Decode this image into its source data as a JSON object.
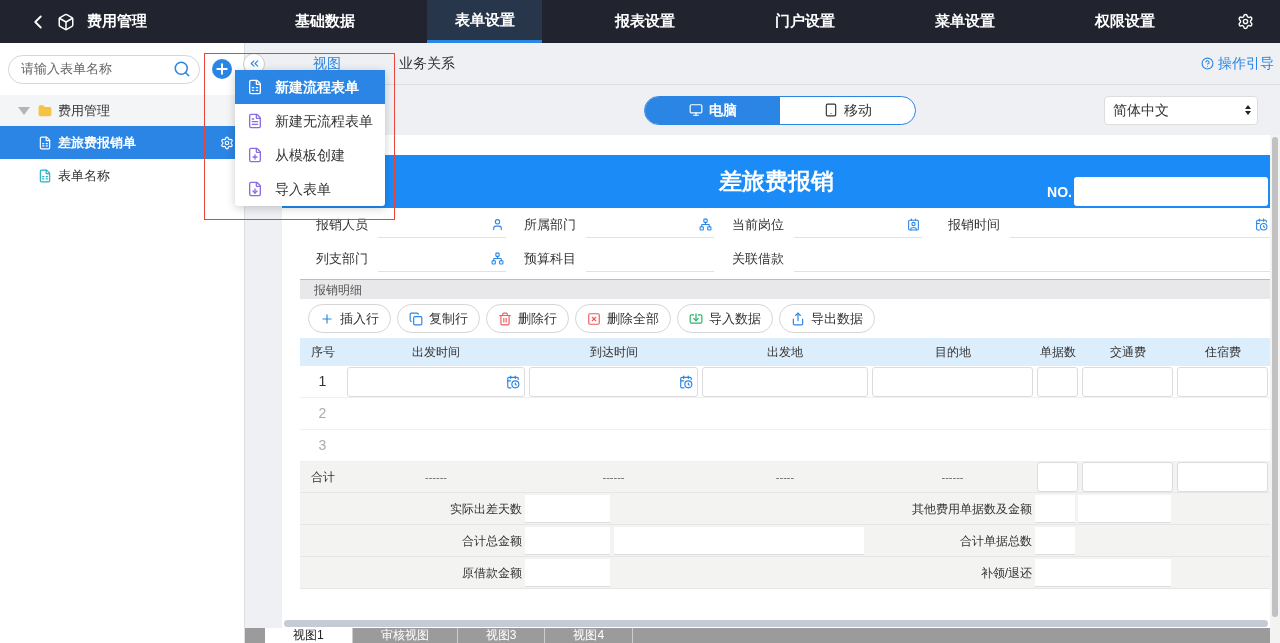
{
  "header": {
    "title": "费用管理",
    "nav": [
      {
        "label": "基础数据",
        "selected": false
      },
      {
        "label": "表单设置",
        "selected": true
      },
      {
        "label": "报表设置",
        "selected": false
      },
      {
        "label": "门户设置",
        "selected": false
      },
      {
        "label": "菜单设置",
        "selected": false
      },
      {
        "label": "权限设置",
        "selected": false
      }
    ]
  },
  "sidebar": {
    "search": {
      "placeholder": "请输入表单名称"
    },
    "tree": [
      {
        "label": "费用管理",
        "expanded": true,
        "children": [
          {
            "label": "差旅费报销单",
            "selected": true
          },
          {
            "label": "表单名称",
            "selected": false
          }
        ]
      }
    ]
  },
  "add_menu": {
    "items": [
      {
        "label": "新建流程表单",
        "kind": "flow",
        "selected": true
      },
      {
        "label": "新建无流程表单",
        "kind": "plain",
        "selected": false
      },
      {
        "label": "从模板创建",
        "kind": "template",
        "selected": false
      },
      {
        "label": "导入表单",
        "kind": "import",
        "selected": false
      }
    ]
  },
  "tabs": [
    {
      "label": "视图",
      "selected": true
    },
    {
      "label": "业务关系",
      "selected": false
    }
  ],
  "help_link": "操作引导",
  "device_toggle": [
    {
      "label": "电脑",
      "kind": "desktop",
      "selected": true
    },
    {
      "label": "移动",
      "kind": "mobile",
      "selected": false
    }
  ],
  "language_select": {
    "value": "简体中文"
  },
  "form": {
    "title": "差旅费报销",
    "no_label": "NO.",
    "field_rows": [
      [
        {
          "label": "报销人员",
          "kind": "person"
        },
        {
          "label": "所属部门",
          "kind": "org"
        },
        {
          "label": "当前岗位",
          "kind": "badge"
        },
        {
          "label": "报销时间",
          "kind": "calendar"
        }
      ],
      [
        {
          "label": "列支部门",
          "kind": "org"
        },
        {
          "label": "预算科目",
          "kind": "text"
        },
        {
          "label": "关联借款",
          "kind": "text"
        }
      ]
    ],
    "section": "报销明细",
    "actions": [
      {
        "label": "插入行",
        "kind": "add"
      },
      {
        "label": "复制行",
        "kind": "copy"
      },
      {
        "label": "删除行",
        "kind": "delete"
      },
      {
        "label": "删除全部",
        "kind": "delete_all"
      },
      {
        "label": "导入数据",
        "kind": "import"
      },
      {
        "label": "导出数据",
        "kind": "export"
      }
    ],
    "table": {
      "columns": [
        {
          "label": "序号",
          "kind": "index"
        },
        {
          "label": "出发时间",
          "kind": "date"
        },
        {
          "label": "到达时间",
          "kind": "date"
        },
        {
          "label": "出发地",
          "kind": "text"
        },
        {
          "label": "目的地",
          "kind": "text"
        },
        {
          "label": "单据数",
          "kind": "number"
        },
        {
          "label": "交通费",
          "kind": "number"
        },
        {
          "label": "住宿费",
          "kind": "number"
        }
      ],
      "rows": [
        {
          "index": "1",
          "editable": true
        },
        {
          "index": "2",
          "editable": false
        },
        {
          "index": "3",
          "editable": false
        }
      ],
      "totals": {
        "label": "合计",
        "dashes": [
          "------",
          "------",
          "-----",
          "------"
        ]
      },
      "summary": [
        {
          "left_label": "实际出差天数",
          "wide_field": false,
          "right_label": "其他费用单据数及金额",
          "kind": "pair"
        },
        {
          "left_label": "合计总金额",
          "wide_field": true,
          "right_label": "合计单据总数",
          "kind": "single"
        },
        {
          "left_label": "原借款金额",
          "wide_field": false,
          "right_label": "补领/退还",
          "kind": "long"
        }
      ]
    }
  },
  "view_tabs": [
    {
      "label": "视图1",
      "selected": true
    },
    {
      "label": "审核视图",
      "selected": false
    },
    {
      "label": "视图3",
      "selected": false
    },
    {
      "label": "视图4",
      "selected": false
    }
  ]
}
